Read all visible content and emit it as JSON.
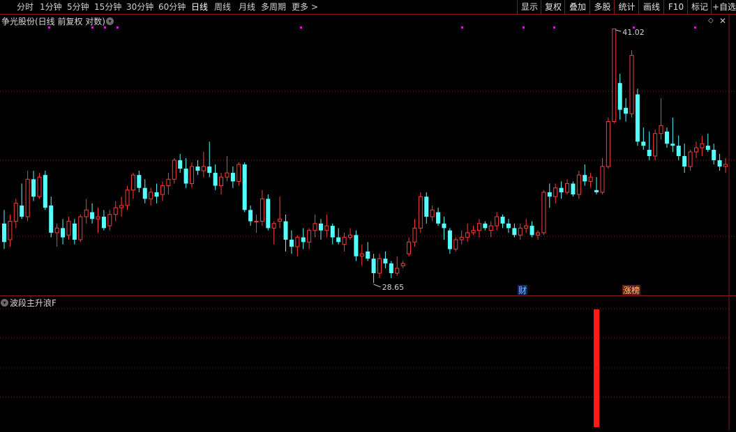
{
  "toolbar": {
    "periods": [
      {
        "label": "分时",
        "active": false
      },
      {
        "label": "1分钟",
        "active": false
      },
      {
        "label": "5分钟",
        "active": false
      },
      {
        "label": "15分钟",
        "active": false
      },
      {
        "label": "30分钟",
        "active": false
      },
      {
        "label": "60分钟",
        "active": false
      },
      {
        "label": "日线",
        "active": true
      },
      {
        "label": "周线",
        "active": false
      },
      {
        "label": "月线",
        "active": false
      },
      {
        "label": "多周期",
        "active": false
      },
      {
        "label": "更多 >",
        "active": false
      }
    ],
    "actions": [
      "显示",
      "复权",
      "叠加",
      "多股",
      "统计",
      "画线",
      "F10",
      "标记",
      "+自选"
    ]
  },
  "main": {
    "title": "争光股份(日线 前复权 对数)",
    "high_label": "41.02",
    "low_label": "28.65",
    "markers": {
      "cai": "财",
      "zhangbang": "涨榜"
    },
    "colors": {
      "up": "#ff3b3b",
      "down": "#54ffff",
      "grid": "#8b1a1a",
      "dot": "#ff00ff"
    }
  },
  "indicator": {
    "title": "波段主升浪F",
    "signal": {
      "bar_index": 101,
      "color": "#ff1a1a"
    }
  },
  "chart_data": {
    "type": "candlestick",
    "title": "争光股份(日线 前复权 对数)",
    "high": 41.02,
    "low": 28.65,
    "candles_ohlc": [
      [
        31.2,
        31.8,
        30.1,
        30.4
      ],
      [
        30.5,
        31.6,
        30.2,
        31.3
      ],
      [
        31.3,
        32.3,
        31.0,
        32.1
      ],
      [
        32.0,
        33.0,
        31.4,
        31.5
      ],
      [
        31.5,
        33.6,
        31.3,
        33.2
      ],
      [
        33.2,
        33.6,
        32.2,
        32.4
      ],
      [
        32.4,
        33.5,
        32.3,
        33.3
      ],
      [
        33.4,
        33.6,
        31.8,
        31.9
      ],
      [
        32.0,
        32.4,
        30.6,
        30.8
      ],
      [
        30.8,
        31.2,
        30.2,
        31.0
      ],
      [
        31.0,
        31.4,
        30.3,
        30.6
      ],
      [
        30.7,
        31.5,
        30.5,
        31.3
      ],
      [
        31.2,
        31.4,
        30.3,
        30.5
      ],
      [
        30.5,
        31.6,
        30.4,
        31.5
      ],
      [
        31.5,
        32.3,
        31.2,
        31.8
      ],
      [
        31.7,
        32.1,
        31.2,
        31.4
      ],
      [
        31.4,
        31.9,
        30.8,
        31.5
      ],
      [
        31.5,
        31.8,
        30.9,
        31.0
      ],
      [
        31.1,
        31.8,
        30.9,
        31.6
      ],
      [
        31.6,
        32.2,
        31.3,
        31.9
      ],
      [
        31.9,
        32.4,
        31.5,
        32.0
      ],
      [
        32.0,
        32.9,
        31.8,
        32.7
      ],
      [
        32.7,
        33.5,
        32.3,
        33.4
      ],
      [
        33.4,
        33.6,
        32.6,
        32.8
      ],
      [
        32.8,
        33.2,
        32.1,
        32.3
      ],
      [
        32.3,
        32.8,
        32.0,
        32.6
      ],
      [
        32.6,
        33.0,
        32.1,
        32.4
      ],
      [
        32.5,
        33.1,
        32.2,
        32.9
      ],
      [
        32.9,
        33.5,
        32.5,
        33.2
      ],
      [
        33.2,
        34.2,
        33.0,
        34.1
      ],
      [
        34.1,
        34.4,
        33.5,
        33.7
      ],
      [
        33.7,
        34.2,
        32.8,
        33.0
      ],
      [
        33.0,
        34.0,
        32.8,
        33.8
      ],
      [
        33.8,
        34.1,
        33.4,
        33.6
      ],
      [
        33.6,
        34.5,
        33.3,
        33.8
      ],
      [
        33.8,
        35.0,
        33.3,
        33.5
      ],
      [
        33.5,
        33.9,
        32.7,
        32.9
      ],
      [
        32.9,
        33.5,
        32.5,
        33.3
      ],
      [
        33.3,
        34.3,
        33.1,
        33.5
      ],
      [
        33.5,
        33.8,
        32.8,
        33.1
      ],
      [
        33.1,
        34.0,
        32.9,
        33.9
      ],
      [
        33.9,
        34.0,
        31.7,
        31.8
      ],
      [
        31.8,
        32.0,
        31.1,
        31.3
      ],
      [
        31.3,
        31.6,
        30.8,
        31.3
      ],
      [
        31.3,
        32.7,
        31.1,
        32.3
      ],
      [
        32.3,
        32.5,
        30.9,
        31.0
      ],
      [
        31.0,
        31.3,
        30.3,
        31.2
      ],
      [
        31.3,
        32.4,
        31.0,
        31.4
      ],
      [
        31.3,
        31.6,
        30.0,
        30.5
      ],
      [
        30.5,
        30.9,
        29.9,
        30.2
      ],
      [
        30.2,
        30.7,
        29.8,
        30.6
      ],
      [
        30.6,
        31.0,
        30.1,
        30.4
      ],
      [
        30.4,
        31.0,
        30.1,
        30.9
      ],
      [
        30.9,
        31.6,
        30.6,
        31.2
      ],
      [
        31.2,
        31.4,
        30.5,
        30.9
      ],
      [
        30.9,
        31.6,
        30.6,
        31.1
      ],
      [
        31.1,
        31.2,
        30.3,
        30.6
      ],
      [
        30.6,
        31.0,
        30.3,
        30.4
      ],
      [
        30.3,
        30.8,
        30.0,
        30.6
      ],
      [
        30.6,
        31.0,
        30.5,
        30.7
      ],
      [
        30.7,
        30.9,
        29.6,
        29.8
      ],
      [
        29.8,
        30.3,
        29.4,
        29.9
      ],
      [
        30.0,
        30.4,
        29.6,
        29.7
      ],
      [
        29.7,
        29.9,
        28.7,
        29.1
      ],
      [
        29.1,
        29.9,
        28.9,
        29.7
      ],
      [
        29.7,
        30.0,
        29.3,
        29.5
      ],
      [
        29.5,
        29.6,
        28.9,
        29.1
      ],
      [
        29.1,
        29.8,
        29.0,
        29.3
      ],
      [
        29.4,
        29.6,
        29.3,
        29.5
      ],
      [
        29.9,
        30.6,
        29.8,
        30.4
      ],
      [
        30.4,
        31.4,
        30.2,
        31.0
      ],
      [
        31.0,
        32.6,
        30.8,
        32.4
      ],
      [
        32.4,
        32.6,
        31.2,
        31.5
      ],
      [
        31.5,
        32.0,
        31.3,
        31.8
      ],
      [
        31.7,
        31.9,
        31.1,
        31.2
      ],
      [
        31.2,
        31.5,
        30.5,
        31.0
      ],
      [
        30.9,
        31.0,
        29.9,
        30.1
      ],
      [
        30.1,
        30.6,
        30.0,
        30.5
      ],
      [
        30.5,
        30.9,
        30.3,
        30.6
      ],
      [
        30.6,
        31.2,
        30.4,
        30.8
      ],
      [
        30.8,
        31.1,
        30.7,
        30.9
      ],
      [
        30.9,
        31.4,
        30.6,
        31.2
      ],
      [
        31.2,
        31.3,
        30.9,
        31.0
      ],
      [
        30.9,
        31.3,
        30.6,
        31.1
      ],
      [
        31.1,
        31.7,
        30.9,
        31.5
      ],
      [
        31.5,
        31.6,
        31.0,
        31.2
      ],
      [
        31.2,
        31.4,
        30.8,
        31.0
      ],
      [
        31.0,
        31.2,
        30.6,
        30.7
      ],
      [
        30.7,
        31.2,
        30.5,
        31.0
      ],
      [
        31.0,
        31.4,
        30.8,
        31.1
      ],
      [
        31.1,
        31.3,
        30.6,
        30.7
      ],
      [
        30.7,
        30.9,
        30.5,
        30.8
      ],
      [
        30.8,
        32.7,
        30.7,
        32.6
      ],
      [
        32.6,
        33.0,
        31.9,
        32.4
      ],
      [
        32.4,
        33.0,
        32.1,
        32.8
      ],
      [
        32.8,
        33.1,
        32.3,
        32.6
      ],
      [
        32.6,
        33.2,
        32.5,
        33.0
      ],
      [
        33.0,
        33.1,
        32.4,
        32.5
      ],
      [
        32.5,
        33.6,
        32.3,
        33.4
      ],
      [
        33.4,
        33.9,
        32.9,
        33.1
      ],
      [
        33.1,
        33.5,
        32.8,
        33.3
      ],
      [
        32.7,
        33.3,
        32.5,
        32.6
      ],
      [
        32.6,
        34.2,
        32.5,
        33.8
      ],
      [
        33.8,
        36.2,
        33.7,
        36.0
      ],
      [
        36.0,
        41.02,
        35.9,
        41.0
      ],
      [
        38.0,
        38.5,
        36.1,
        36.6
      ],
      [
        36.7,
        37.2,
        36.0,
        36.4
      ],
      [
        36.4,
        39.8,
        36.2,
        39.5
      ],
      [
        37.4,
        37.7,
        34.8,
        35.0
      ],
      [
        35.0,
        35.7,
        34.6,
        34.8
      ],
      [
        34.6,
        35.5,
        34.1,
        34.3
      ],
      [
        34.3,
        35.6,
        34.1,
        35.4
      ],
      [
        35.4,
        37.2,
        35.1,
        35.8
      ],
      [
        35.5,
        35.7,
        34.7,
        34.9
      ],
      [
        34.9,
        36.2,
        34.5,
        34.8
      ],
      [
        34.8,
        35.3,
        34.1,
        34.3
      ],
      [
        34.3,
        34.9,
        33.5,
        33.8
      ],
      [
        33.8,
        34.6,
        33.6,
        34.5
      ],
      [
        34.5,
        35.0,
        34.2,
        34.7
      ],
      [
        34.7,
        35.3,
        34.3,
        34.9
      ],
      [
        34.8,
        35.4,
        34.5,
        34.6
      ],
      [
        34.6,
        34.9,
        33.9,
        34.1
      ],
      [
        34.1,
        34.4,
        33.6,
        33.8
      ],
      [
        33.8,
        34.2,
        33.5,
        33.9
      ]
    ]
  }
}
